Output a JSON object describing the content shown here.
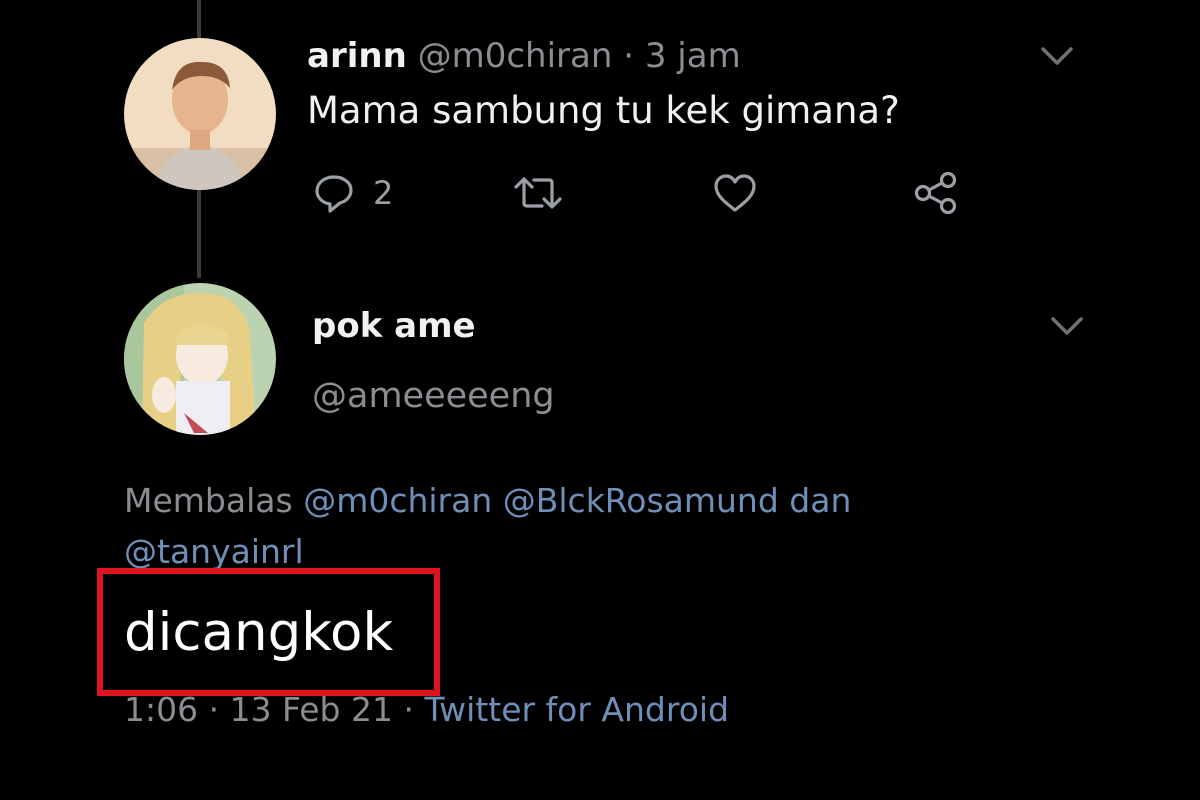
{
  "tweet1": {
    "display_name": "arinn",
    "handle": "@m0chiran",
    "separator": "·",
    "time": "3 jam",
    "text": "Mama sambung tu kek gimana?",
    "reply_count": "2"
  },
  "tweet2": {
    "display_name": "pok ame",
    "handle": "@ameeeeeng",
    "reply_prefix": "Membalas",
    "reply_mentions": "@m0chiran @BlckRosamund",
    "reply_conj": "dan",
    "reply_mention_last": "@tanyainrl",
    "text": "dicangkok",
    "timestamp": "1:06 · 13 Feb 21",
    "separator": "·",
    "source": "Twitter for Android"
  },
  "colors": {
    "background": "#000000",
    "text": "#e7e9ea",
    "muted": "#8a8d91",
    "link": "#6f8fb8",
    "highlight": "#e0141e"
  },
  "icons": [
    "reply-icon",
    "retweet-icon",
    "like-icon",
    "share-icon",
    "chevron-down-icon"
  ]
}
